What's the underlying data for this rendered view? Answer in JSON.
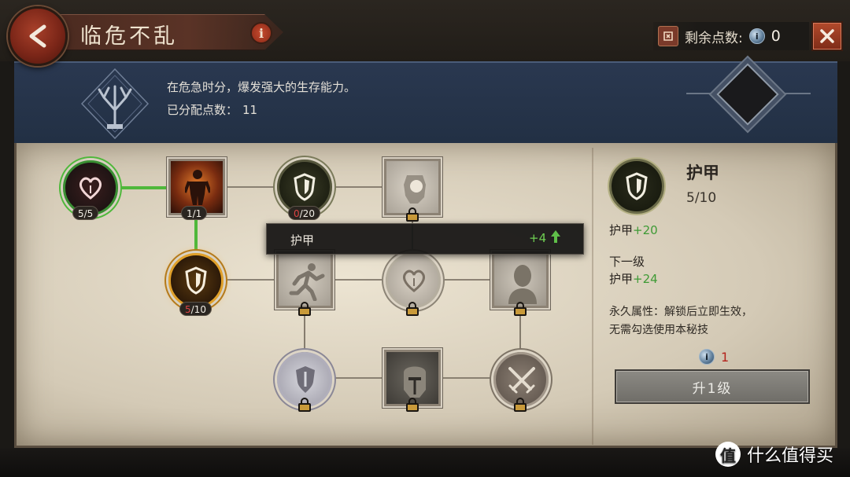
{
  "header": {
    "title": "临危不乱",
    "info_glyph": "i",
    "points_label": "剩余点数:",
    "points_value": "0",
    "coin_glyph": "i"
  },
  "description": {
    "text": "在危急时分，爆发强大的生存能力。",
    "allocated_label": "已分配点数：",
    "allocated_value": "11"
  },
  "tree": {
    "nodes": [
      {
        "id": "heart-1",
        "count": "5/5"
      },
      {
        "id": "body-1",
        "count": "1/1"
      },
      {
        "id": "shield-top",
        "count_cur": "0",
        "count_max": "/20"
      },
      {
        "id": "shield-mid",
        "count_cur": "5",
        "count_max": "/10"
      }
    ]
  },
  "tooltip": {
    "label": "护甲",
    "value": "+4"
  },
  "detail": {
    "name": "护甲",
    "level": "5/10",
    "stat_label": "护甲",
    "stat_value": "+20",
    "next_level_label": "下一级",
    "next_stat_label": "护甲",
    "next_stat_value": "+24",
    "note_line1": "永久属性：解锁后立即生效，",
    "note_line2": "无需勾选使用本秘技",
    "cost": "1",
    "upgrade_label": "升1级"
  },
  "watermark": {
    "logo_glyph": "值",
    "text": "什么值得买"
  },
  "colors": {
    "link_active": "#4fb83b",
    "stat_plus": "#3e9a35",
    "cost_red": "#b4231c",
    "parchment": "#d4cab6"
  },
  "icons": [
    "back-arrow-icon",
    "info-icon",
    "points-icon",
    "coin-icon",
    "close-icon",
    "tree-emblem-icon",
    "shield-icon",
    "heart-icon",
    "body-icon",
    "runner-icon",
    "lock-icon",
    "up-arrow-icon",
    "crossed-swords-icon",
    "knight-helmet-icon",
    "head-icon",
    "fist-icon"
  ]
}
